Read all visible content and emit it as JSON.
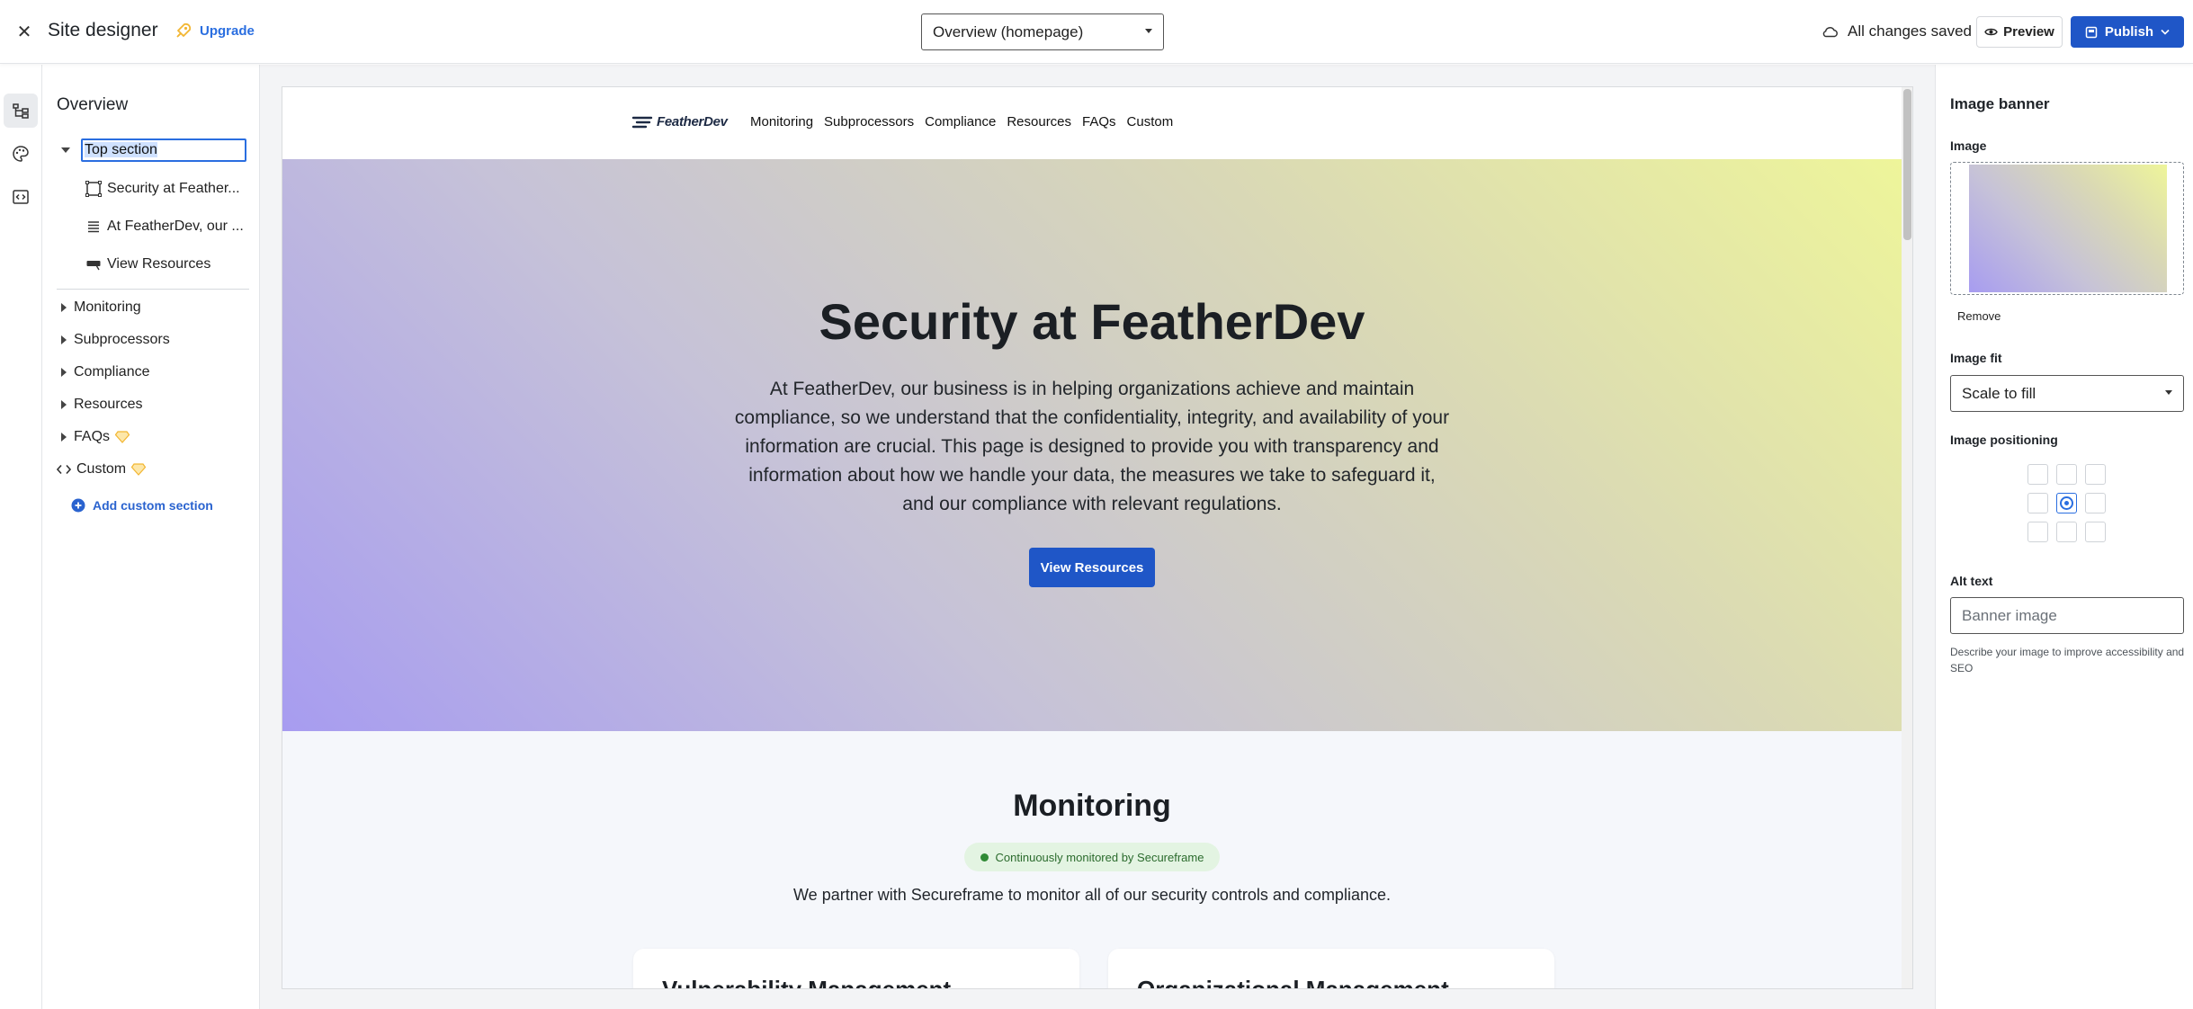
{
  "topbar": {
    "title": "Site designer",
    "upgrade_label": "Upgrade",
    "page_selector": "Overview (homepage)",
    "save_status": "All changes saved",
    "preview_label": "Preview",
    "publish_label": "Publish"
  },
  "rail": {
    "items": [
      {
        "icon": "structure-icon",
        "active": true
      },
      {
        "icon": "palette-icon",
        "active": false
      },
      {
        "icon": "code-embed-icon",
        "active": false
      }
    ]
  },
  "tree": {
    "title": "Overview",
    "top_section": "Top section",
    "children": [
      {
        "icon": "image-banner-icon",
        "label": "Security at Feather..."
      },
      {
        "icon": "text-lines-icon",
        "label": "At FeatherDev, our ..."
      },
      {
        "icon": "button-icon",
        "label": "View Resources"
      }
    ],
    "sections": [
      "Monitoring",
      "Subprocessors",
      "Compliance",
      "Resources",
      "FAQs",
      "Custom"
    ],
    "add_custom": "Add custom section"
  },
  "preview": {
    "brand": "FeatherDev",
    "nav": [
      "Monitoring",
      "Subprocessors",
      "Compliance",
      "Resources",
      "FAQs",
      "Custom"
    ],
    "hero_title": "Security at FeatherDev",
    "hero_body": "At FeatherDev, our business is in helping organizations achieve and maintain compliance, so we understand that the confidentiality, integrity, and availability of your information are crucial. This page is designed to provide you with transparency and information about how we handle your data, the measures we take to safeguard it, and our compliance with relevant regulations.",
    "hero_button": "View Resources",
    "monitoring_title": "Monitoring",
    "monitoring_badge": "Continuously monitored by Secureframe",
    "monitoring_desc": "We partner with Secureframe to monitor all of our security controls and compliance.",
    "cards": [
      "Vulnerability Management",
      "Organizational Management"
    ]
  },
  "inspector": {
    "title": "Image banner",
    "image_label": "Image",
    "remove_label": "Remove",
    "fit_label": "Image fit",
    "fit_value": "Scale to fill",
    "positioning_label": "Image positioning",
    "alt_label": "Alt text",
    "alt_placeholder": "Banner image",
    "alt_help": "Describe your image to improve accessibility and SEO"
  },
  "colors": {
    "accent": "#1f56c7",
    "link": "#2a6ee0",
    "gem": "#f2b632",
    "banner_start": "#a79cf0",
    "banner_end": "#eef59a"
  }
}
